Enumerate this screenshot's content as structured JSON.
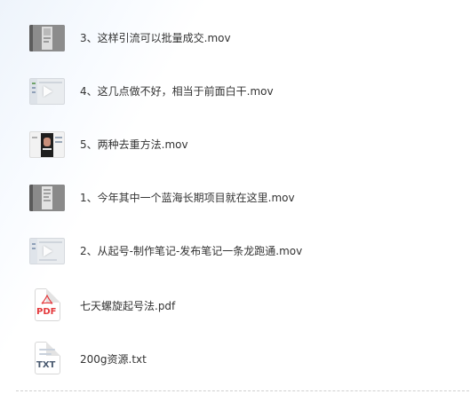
{
  "files": [
    {
      "name": "3、这样引流可以批量成交.mov",
      "type": "video",
      "icon": "video-thumbnail-icon"
    },
    {
      "name": "4、这几点做不好，相当于前面白干.mov",
      "type": "video",
      "icon": "video-thumbnail-icon"
    },
    {
      "name": "5、两种去重方法.mov",
      "type": "video",
      "icon": "video-thumbnail-icon"
    },
    {
      "name": "1、今年其中一个蓝海长期项目就在这里.mov",
      "type": "video",
      "icon": "video-thumbnail-icon"
    },
    {
      "name": "2、从起号-制作笔记-发布笔记一条龙跑通.mov",
      "type": "video",
      "icon": "video-thumbnail-icon"
    },
    {
      "name": "七天螺旋起号法.pdf",
      "type": "pdf",
      "icon": "pdf-file-icon",
      "badge": "PDF",
      "badge_color": "#e4393c"
    },
    {
      "name": "200g资源.txt",
      "type": "txt",
      "icon": "txt-file-icon",
      "badge": "TXT",
      "badge_color": "#4a5a70"
    }
  ],
  "colors": {
    "text": "#333333",
    "pdf": "#e4393c",
    "txt": "#4a5a70",
    "play": "#ffffff"
  }
}
